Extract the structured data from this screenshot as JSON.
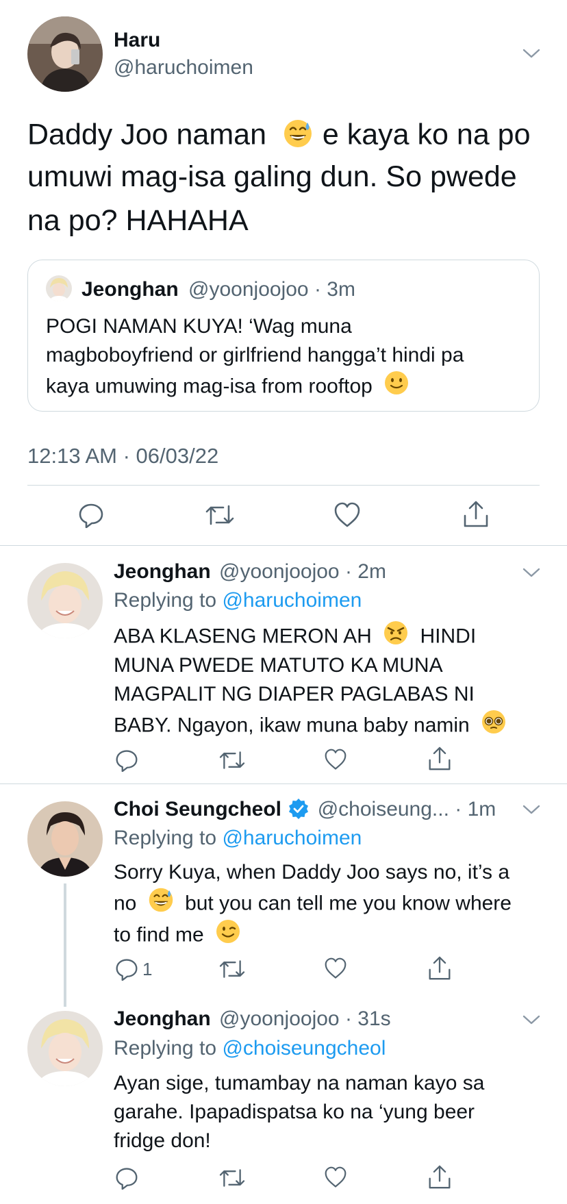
{
  "main_tweet": {
    "author_name": "Haru",
    "author_handle": "@haruchoimen",
    "text_part1": "Daddy Joo naman",
    "text_part2": " e kaya ko na po",
    "text_line2": "umuwi mag-isa galing dun. So pwede",
    "text_line3": "na po? HAHAHA",
    "emoji1": "grinning-sweat-emoji",
    "quote": {
      "name": "Jeonghan",
      "handle": "@yoonjoojoo",
      "time": "· 3m",
      "line1": "POGI NAMAN KUYA! ‘Wag muna",
      "line2": "magboboyfriend or girlfriend hangga’t hindi pa",
      "line3": "kaya umuwing mag-isa from rooftop"
    },
    "timestamp": "12:13 AM · 06/03/22"
  },
  "replies": [
    {
      "name": "Jeonghan",
      "handle": "@yoonjoojoo",
      "time": "· 2m",
      "replying_label": "Replying to",
      "replying_to": "@haruchoimen",
      "line1a": "ABA KLASENG MERON AH",
      "line1b": "HINDI",
      "line2": "MUNA PWEDE MATUTO KA MUNA",
      "line3": "MAGPALIT NG DIAPER PAGLABAS NI",
      "line4": "BABY. Ngayon, ikaw muna baby namin"
    },
    {
      "name": "Choi Seungcheol",
      "handle": "@choiseung...",
      "time": "· 1m",
      "replying_label": "Replying to",
      "replying_to": "@haruchoimen",
      "line1": "Sorry Kuya, when Daddy Joo says no, it’s a",
      "line2a": "no",
      "line2b": "but you can tell me you know where",
      "line3": "to find me",
      "reply_count": "1"
    },
    {
      "name": "Jeonghan",
      "handle": "@yoonjoojoo",
      "time": "· 31s",
      "replying_label": "Replying to",
      "replying_to": "@choiseungcheol",
      "line1": "Ayan sige, tumambay na naman kayo sa",
      "line2": "garahe. Ipapadispatsa ko na ‘yung beer",
      "line3": "fridge don!"
    }
  ],
  "colors": {
    "text": "#0f1419",
    "muted": "#536471",
    "link": "#1d9bf0",
    "divider": "#cfd9de",
    "verified": "#1d9bf0"
  }
}
